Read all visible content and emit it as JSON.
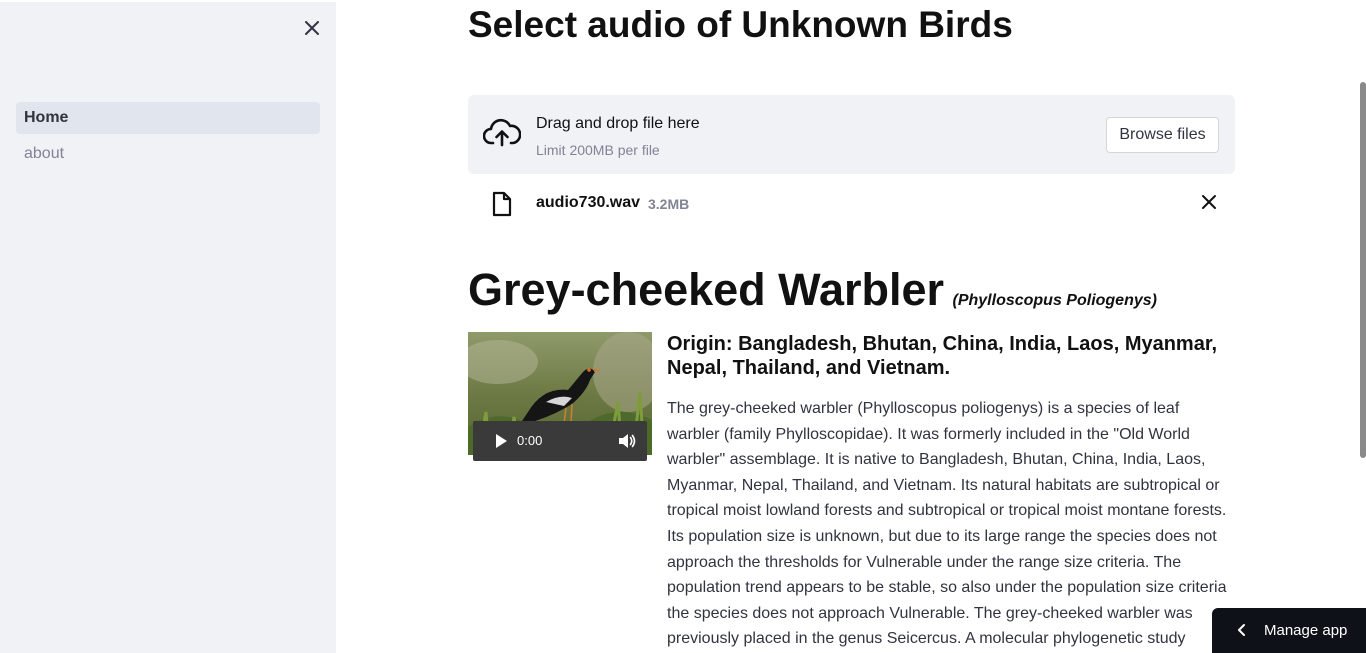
{
  "sidebar": {
    "close_icon": "close-icon",
    "items": [
      {
        "label": "Home",
        "active": true
      },
      {
        "label": "about",
        "active": false
      }
    ]
  },
  "main": {
    "title": "Select audio of Unknown Birds",
    "uploader": {
      "icon": "cloud-upload-icon",
      "title": "Drag and drop file here",
      "limit": "Limit 200MB per file",
      "browse_label": "Browse files"
    },
    "file": {
      "icon": "file-icon",
      "name": "audio730.wav",
      "size": "3.2MB",
      "remove_icon": "close-icon"
    },
    "bird": {
      "name": "Grey-cheeked Warbler",
      "scientific": "(Phylloscopus Poliogenys)",
      "origin": "Origin: Bangladesh, Bhutan, China, India, Laos, Myanmar, Nepal, Thailand, and Vietnam.",
      "description": "The grey-cheeked warbler (Phylloscopus poliogenys) is a species of leaf warbler (family Phylloscopidae). It was formerly included in the \"Old World warbler\" assemblage. It is native to Bangladesh, Bhutan, China, India, Laos, Myanmar, Nepal, Thailand, and Vietnam. Its natural habitats are subtropical or tropical moist lowland forests and subtropical or tropical moist montane forests. Its population size is unknown, but due to its large range the species does not approach the thresholds for Vulnerable under the range size criteria. The population trend appears to be stable, so also under the population size criteria the species does not approach Vulnerable. The grey-cheeked warbler was previously placed in the genus Seicercus. A molecular phylogenetic study"
    },
    "audio": {
      "time": "0:00",
      "play_icon": "play-icon",
      "volume_icon": "volume-icon"
    }
  },
  "manage_app": {
    "label": "Manage app",
    "icon": "chevron-left-icon"
  },
  "colors": {
    "sidebar_bg": "#f0f2f6",
    "active_item_bg": "#e1e5ed",
    "text": "#31333f",
    "muted": "#808495",
    "manage_bg": "#0e1117"
  }
}
